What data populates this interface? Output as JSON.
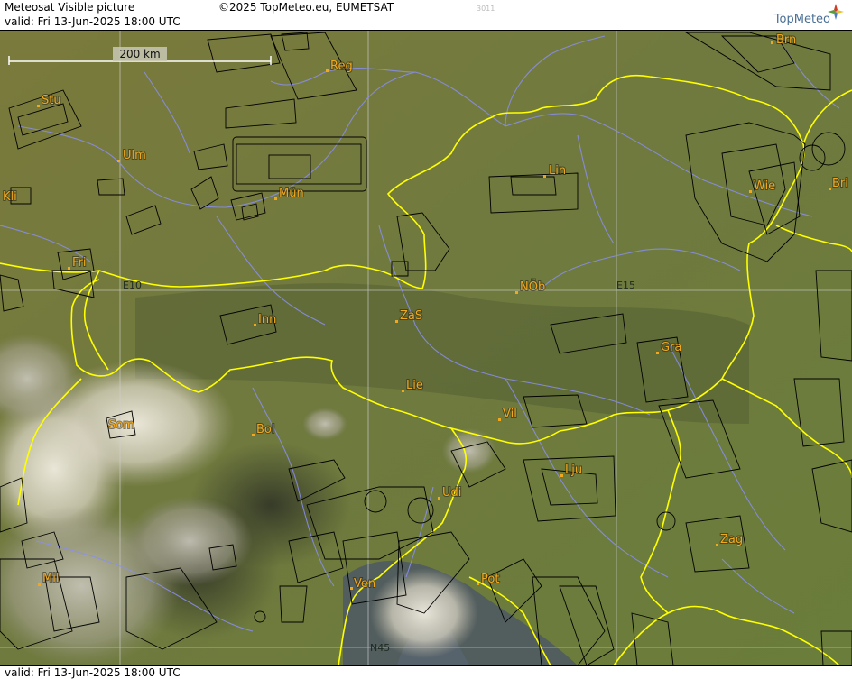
{
  "header": {
    "title": "Meteosat Visible picture",
    "copyright": "©2025 TopMeteo.eu, EUMETSAT",
    "code": "3011",
    "valid": "valid:  Fri  13-Jun-2025  18:00 UTC",
    "logo_text": "TopMeteo"
  },
  "footer": {
    "valid": "valid:  Fri  13-Jun-2025  18:00 UTC"
  },
  "map": {
    "scale_label": "200 km",
    "grid_labels": [
      "E10",
      "E15",
      "N45"
    ],
    "cities": [
      "Brn",
      "Reg",
      "Stu",
      "Ulm",
      "Mün",
      "Kli",
      "Lin",
      "Wie",
      "Bri",
      "Fri",
      "NÖb",
      "E15",
      "Inn",
      "ZaS",
      "Gra",
      "Lie",
      "Bol",
      "Som",
      "Vil",
      "Lju",
      "Udi",
      "Zag",
      "Mil",
      "Ven",
      "Pot"
    ]
  },
  "colors": {
    "land": "#7a7f3d",
    "border": "#ffff00",
    "river": "#8a8ff0",
    "airspace": "#000000",
    "city_label": "#f2a81d",
    "grid": "#cfcfcf"
  },
  "icons": [
    "topmeteo-logo-icon"
  ]
}
